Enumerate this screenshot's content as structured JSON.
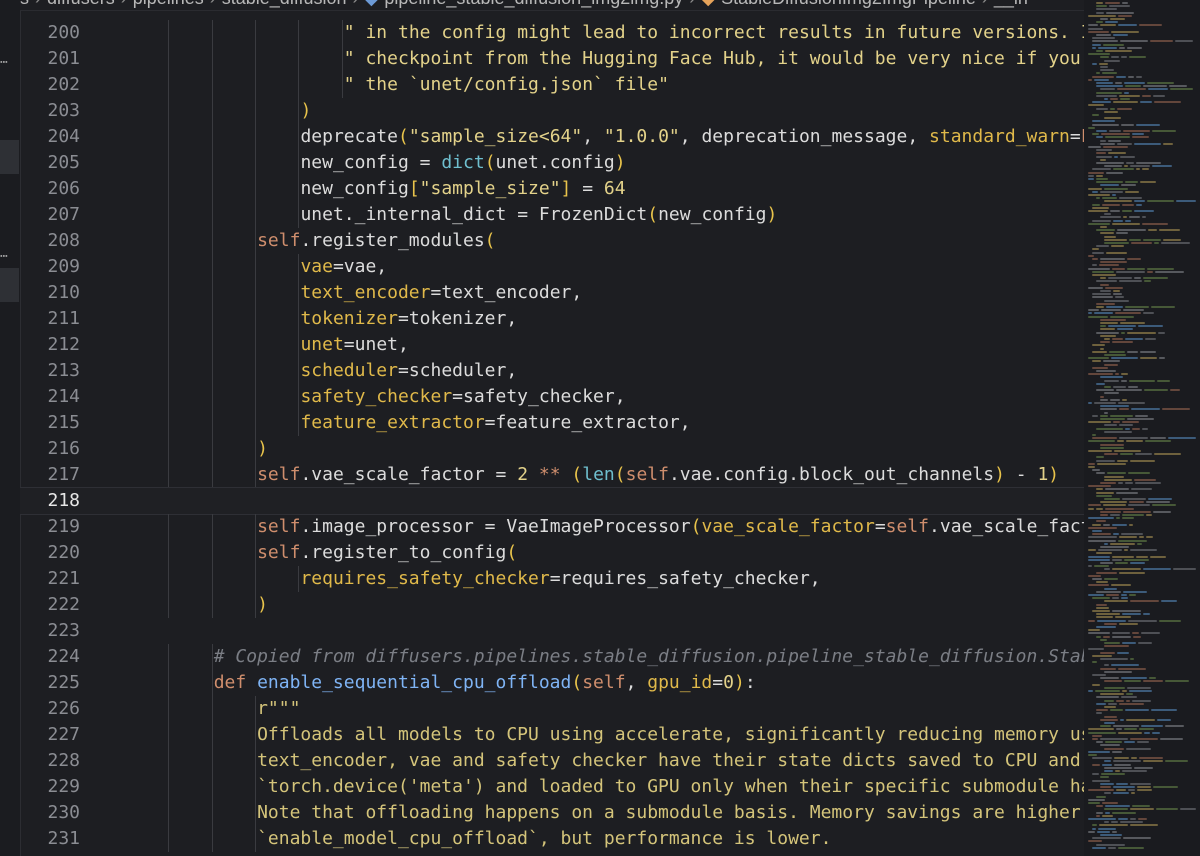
{
  "breadcrumb": {
    "items": [
      "s",
      "diffusers",
      "pipelines",
      "stable_diffusion",
      "pipeline_stable_diffusion_img2img.py",
      "StableDiffusionImg2ImgPipeline",
      "__in"
    ]
  },
  "editor": {
    "first_line": 200,
    "current_line": 218,
    "lines": [
      [
        [
          "s",
          "\" in the config might lead to incorrect results in future versions. If you ha"
        ]
      ],
      [
        [
          "s",
          "\" checkpoint from the Hugging Face Hub, it would be very nice if you could op"
        ]
      ],
      [
        [
          "s",
          "\" the `unet/config.json` file\""
        ]
      ],
      [
        [
          "pr",
          ")"
        ]
      ],
      [
        [
          "n",
          "deprecate"
        ],
        [
          "pr",
          "("
        ],
        [
          "s",
          "\"sample_size<64\""
        ],
        [
          "n",
          ", "
        ],
        [
          "s",
          "\"1.0.0\""
        ],
        [
          "n",
          ", deprecation_message, "
        ],
        [
          "p",
          "standard_warn"
        ],
        [
          "op",
          "="
        ],
        [
          "k",
          "False"
        ],
        [
          "pr",
          ")"
        ]
      ],
      [
        [
          "n",
          "new_config "
        ],
        [
          "op",
          "= "
        ],
        [
          "b",
          "dict"
        ],
        [
          "pr",
          "("
        ],
        [
          "n",
          "unet.config"
        ],
        [
          "pr",
          ")"
        ]
      ],
      [
        [
          "n",
          "new_config"
        ],
        [
          "pr",
          "["
        ],
        [
          "s",
          "\"sample_size\""
        ],
        [
          "pr",
          "]"
        ],
        [
          "op",
          " = "
        ],
        [
          "num",
          "64"
        ]
      ],
      [
        [
          "n",
          "unet._internal_dict "
        ],
        [
          "op",
          "= "
        ],
        [
          "n",
          "FrozenDict"
        ],
        [
          "pr",
          "("
        ],
        [
          "n",
          "new_config"
        ],
        [
          "pr",
          ")"
        ]
      ],
      [
        [
          "k",
          "self"
        ],
        [
          "n",
          ".register_modules"
        ],
        [
          "pr",
          "("
        ]
      ],
      [
        [
          "p",
          "vae"
        ],
        [
          "op",
          "="
        ],
        [
          "n",
          "vae,"
        ]
      ],
      [
        [
          "p",
          "text_encoder"
        ],
        [
          "op",
          "="
        ],
        [
          "n",
          "text_encoder,"
        ]
      ],
      [
        [
          "p",
          "tokenizer"
        ],
        [
          "op",
          "="
        ],
        [
          "n",
          "tokenizer,"
        ]
      ],
      [
        [
          "p",
          "unet"
        ],
        [
          "op",
          "="
        ],
        [
          "n",
          "unet,"
        ]
      ],
      [
        [
          "p",
          "scheduler"
        ],
        [
          "op",
          "="
        ],
        [
          "n",
          "scheduler,"
        ]
      ],
      [
        [
          "p",
          "safety_checker"
        ],
        [
          "op",
          "="
        ],
        [
          "n",
          "safety_checker,"
        ]
      ],
      [
        [
          "p",
          "feature_extractor"
        ],
        [
          "op",
          "="
        ],
        [
          "n",
          "feature_extractor,"
        ]
      ],
      [
        [
          "pr",
          ")"
        ]
      ],
      [
        [
          "k",
          "self"
        ],
        [
          "n",
          ".vae_scale_factor "
        ],
        [
          "op",
          "= "
        ],
        [
          "num",
          "2"
        ],
        [
          "k",
          " ** "
        ],
        [
          "pr",
          "("
        ],
        [
          "b",
          "len"
        ],
        [
          "pr",
          "("
        ],
        [
          "k",
          "self"
        ],
        [
          "n",
          ".vae.config.block_out_channels"
        ],
        [
          "pr",
          ")"
        ],
        [
          "op",
          " - "
        ],
        [
          "num",
          "1"
        ],
        [
          "pr",
          ")"
        ]
      ],
      [],
      [
        [
          "k",
          "self"
        ],
        [
          "n",
          ".image_processor "
        ],
        [
          "op",
          "= "
        ],
        [
          "n",
          "VaeImageProcessor"
        ],
        [
          "pr",
          "("
        ],
        [
          "p",
          "vae_scale_factor"
        ],
        [
          "op",
          "="
        ],
        [
          "k",
          "self"
        ],
        [
          "n",
          ".vae_scale_factor"
        ],
        [
          "pr",
          ")"
        ]
      ],
      [
        [
          "k",
          "self"
        ],
        [
          "n",
          ".register_to_config"
        ],
        [
          "pr",
          "("
        ]
      ],
      [
        [
          "p",
          "requires_safety_checker"
        ],
        [
          "op",
          "="
        ],
        [
          "n",
          "requires_safety_checker,"
        ]
      ],
      [
        [
          "pr",
          ")"
        ]
      ],
      [],
      [
        [
          "c",
          "# Copied from diffusers.pipelines.stable_diffusion.pipeline_stable_diffusion.StableDiffus"
        ]
      ],
      [
        [
          "k",
          "def "
        ],
        [
          "f",
          "enable_sequential_cpu_offload"
        ],
        [
          "pr",
          "("
        ],
        [
          "k",
          "self"
        ],
        [
          "n",
          ", "
        ],
        [
          "p",
          "gpu_id"
        ],
        [
          "op",
          "="
        ],
        [
          "num",
          "0"
        ],
        [
          "pr",
          ")"
        ],
        [
          "n",
          ":"
        ]
      ],
      [
        [
          "doc",
          "r\"\"\""
        ]
      ],
      [
        [
          "doc",
          "Offloads all models to CPU using accelerate, significantly reducing memory usage. Whe"
        ]
      ],
      [
        [
          "doc",
          "text_encoder, vae and safety checker have their state dicts saved to CPU and then are"
        ]
      ],
      [
        [
          "doc",
          "`torch.device('meta') and loaded to GPU only when their specific submodule has its `f"
        ]
      ],
      [
        [
          "doc",
          "Note that offloading happens on a submodule basis. Memory savings are higher than wit"
        ]
      ],
      [
        [
          "doc",
          "`enable_model_cpu_offload`, but performance is lower."
        ]
      ]
    ],
    "indents": [
      6,
      6,
      6,
      5,
      5,
      5,
      5,
      5,
      4,
      5,
      5,
      5,
      5,
      5,
      5,
      5,
      4,
      4,
      0,
      4,
      4,
      5,
      4,
      0,
      3,
      3,
      4,
      4,
      4,
      4,
      4,
      4
    ]
  },
  "colors": {
    "background": "#1d1e22",
    "keyword": "#cf8e6d",
    "string": "#e3d28a",
    "function": "#7fb4f5",
    "comment": "#7b7e85"
  }
}
